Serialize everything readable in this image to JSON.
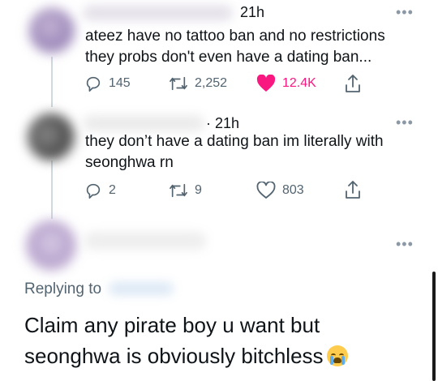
{
  "tweets": [
    {
      "time": "21h",
      "text_line1": "ateez have no tattoo ban and no restrictions",
      "text_line2": "they probs don't even have a dating ban...",
      "replies": "145",
      "retweets": "2,252",
      "likes": "12.4K",
      "liked": true
    },
    {
      "time": "· 21h",
      "text_line1": "they don’t have a dating ban im literally with",
      "text_line2": "seonghwa rn",
      "replies": "2",
      "retweets": "9",
      "likes": "803",
      "liked": false
    }
  ],
  "main_tweet": {
    "replying_label": "Replying to",
    "text_line1": "Claim any pirate boy u want but",
    "text_line2": "seonghwa is obviously bitchless",
    "emoji_name": "loudly-crying-face-emoji"
  },
  "icons": {
    "more": "more-options-icon",
    "reply": "reply-icon",
    "retweet": "retweet-icon",
    "like": "heart-icon",
    "share": "share-icon"
  },
  "colors": {
    "like_active": "#f91880",
    "muted": "#536471",
    "thread_line": "#cfd9de"
  }
}
